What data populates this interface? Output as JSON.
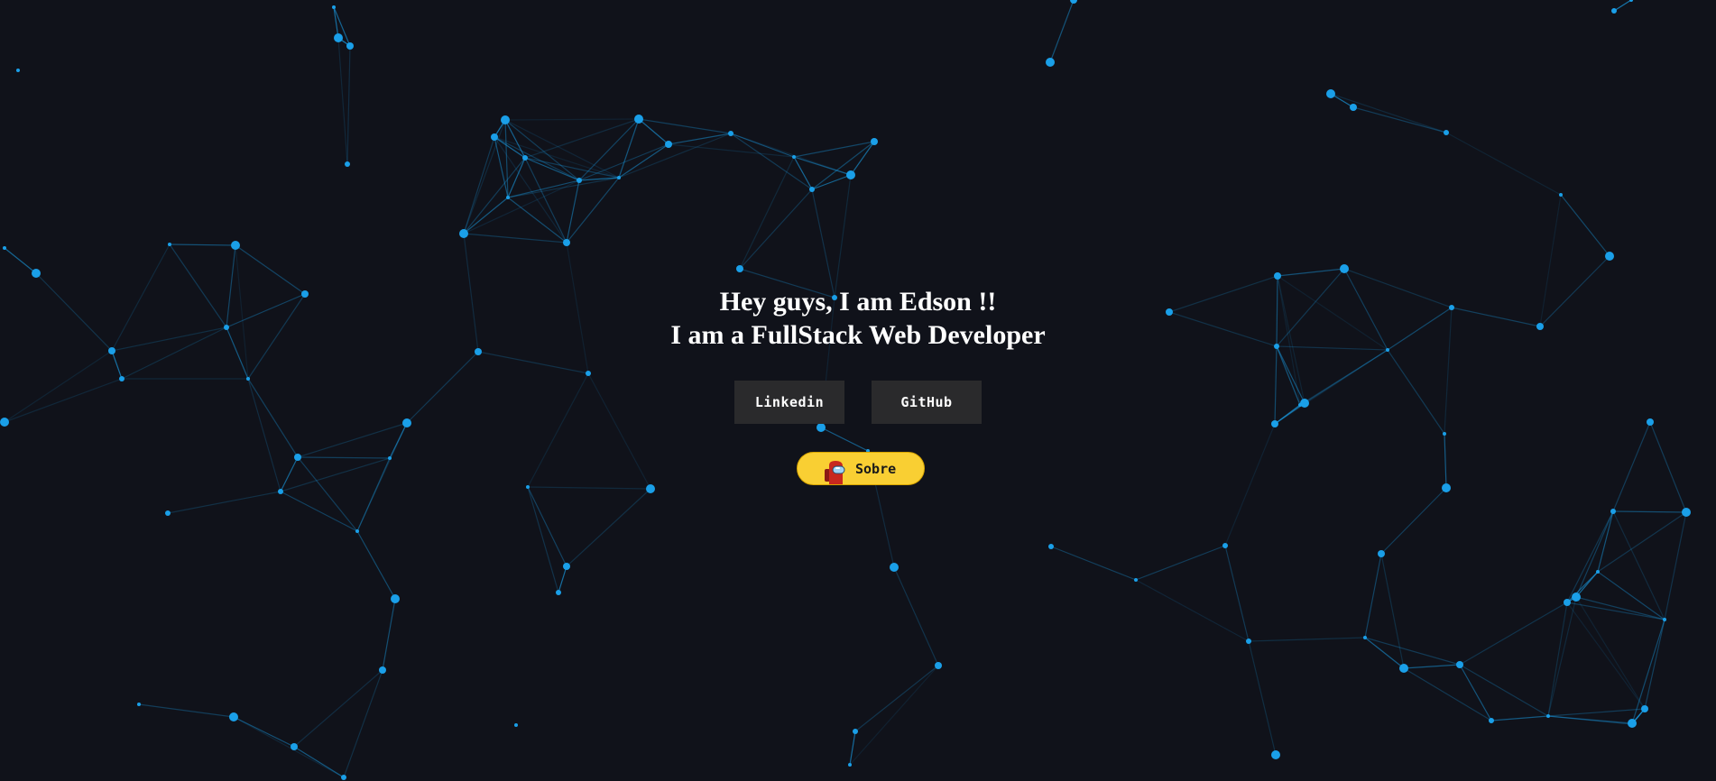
{
  "hero": {
    "line1": "Hey guys, I am Edson !!",
    "line2": "I am a FullStack Web Developer"
  },
  "buttons": {
    "linkedin": "Linkedin",
    "github": "GitHub",
    "sobre": "Sobre"
  },
  "icons": {
    "sobre_icon": "among-us-crewmate-icon"
  },
  "colors": {
    "background": "#10121a",
    "particle": "#1a9fe8",
    "button": "#2a2a2c",
    "sobre": "#f9cf33"
  }
}
